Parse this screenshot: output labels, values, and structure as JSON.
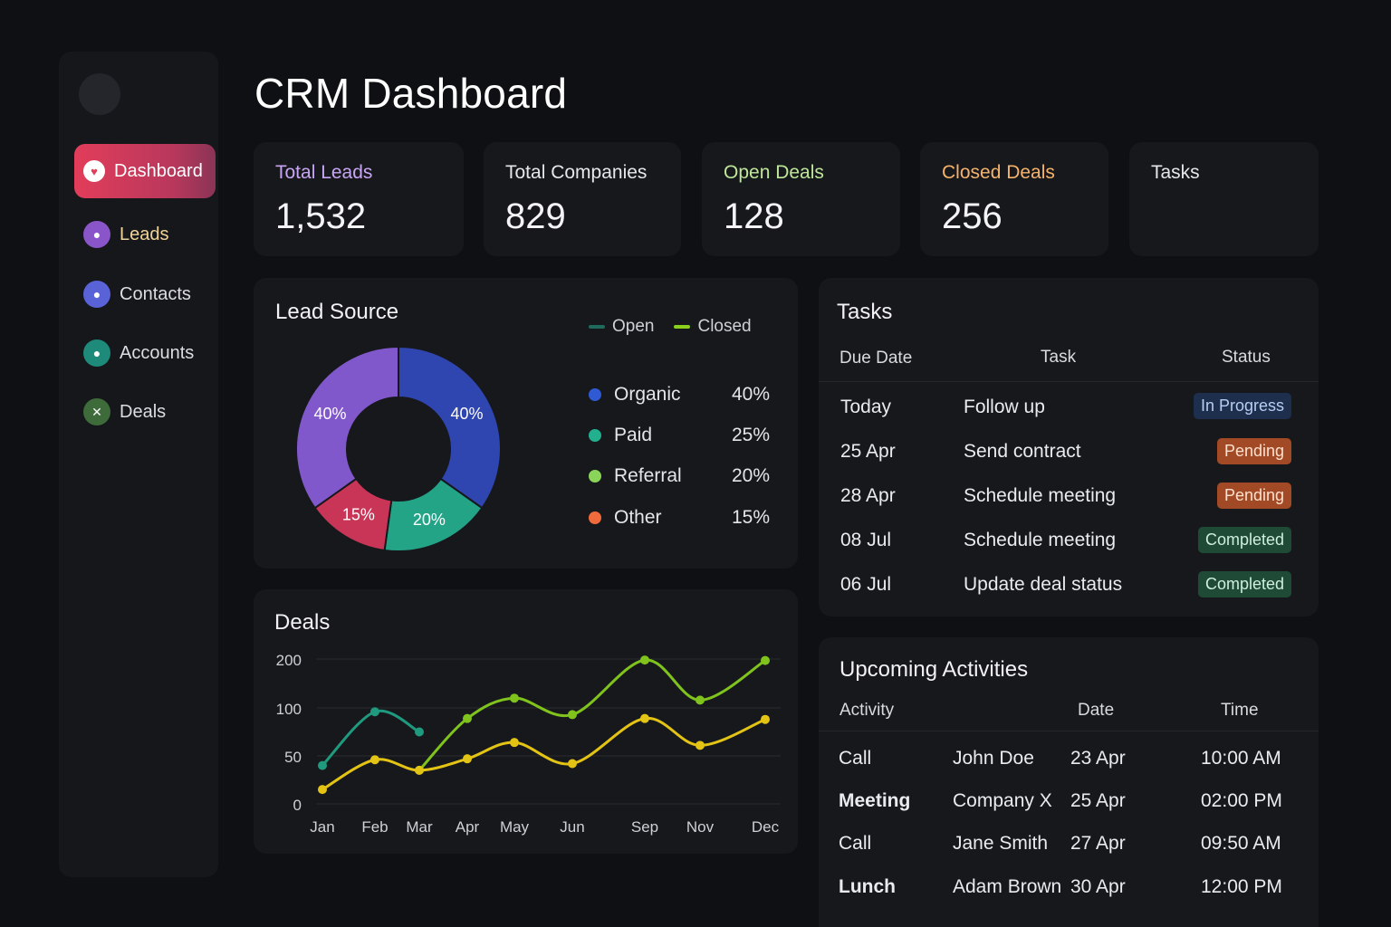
{
  "header": {
    "title": "CRM Dashboard"
  },
  "sidebar": {
    "items": [
      {
        "label": "Dashboard",
        "icon": "heart-icon",
        "active": true
      },
      {
        "label": "Leads",
        "icon": "user-icon",
        "color": "#8a55c9"
      },
      {
        "label": "Contacts",
        "icon": "user-icon",
        "color": "#5a62d8"
      },
      {
        "label": "Accounts",
        "icon": "user-icon",
        "color": "#1e8a7a"
      },
      {
        "label": "Deals",
        "icon": "close-icon",
        "color": "#3d6b3a"
      }
    ]
  },
  "kpis": [
    {
      "label": "Total Leads",
      "value": "1,532",
      "color": "#c8a6f5"
    },
    {
      "label": "Total Companies",
      "value": "829",
      "color": "#e6e7eb"
    },
    {
      "label": "Open Deals",
      "value": "128",
      "color": "#bfe79a"
    },
    {
      "label": "Closed Deals",
      "value": "256",
      "color": "#f5b36c"
    },
    {
      "label": "Tasks",
      "value": "",
      "color": "#e6e7eb"
    }
  ],
  "lead_source": {
    "title": "Lead Source",
    "legend": {
      "open": "Open",
      "closed": "Closed",
      "open_color": "#1e6b5c",
      "closed_color": "#8bd11c"
    },
    "rows": [
      {
        "label": "Organic",
        "pct": "40%",
        "color": "#2f5ad4"
      },
      {
        "label": "Paid",
        "pct": "25%",
        "color": "#22b08f"
      },
      {
        "label": "Referral",
        "pct": "20%",
        "color": "#8bd45a"
      },
      {
        "label": "Other",
        "pct": "15%",
        "color": "#f06a3c"
      }
    ]
  },
  "tasks": {
    "title": "Tasks",
    "headers": {
      "due": "Due Date",
      "task": "Task",
      "status": "Status"
    },
    "rows": [
      {
        "due": "Today",
        "task": "Follow up",
        "status": "In Progress",
        "kind": "progress"
      },
      {
        "due": "25 Apr",
        "task": "Send contract",
        "status": "Pending",
        "kind": "pending"
      },
      {
        "due": "28 Apr",
        "task": "Schedule meeting",
        "status": "Pending",
        "kind": "pending"
      },
      {
        "due": "08 Jul",
        "task": "Schedule meeting",
        "status": "Completed",
        "kind": "completed"
      },
      {
        "due": "06 Jul",
        "task": "Update deal status",
        "status": "Completed",
        "kind": "completed"
      }
    ]
  },
  "activities": {
    "title": "Upcoming Activities",
    "headers": {
      "activity": "Activity",
      "date": "Date",
      "time": "Time"
    },
    "rows": [
      {
        "activity": "Call",
        "who": "John Doe",
        "date": "23 Apr",
        "time": "10:00 AM",
        "bold": false
      },
      {
        "activity": "Meeting",
        "who": "Company X",
        "date": "25 Apr",
        "time": "02:00 PM",
        "bold": true
      },
      {
        "activity": "Call",
        "who": "Jane Smith",
        "date": "27 Apr",
        "time": "09:50 AM",
        "bold": false
      },
      {
        "activity": "Lunch",
        "who": "Adam Brown",
        "date": "30 Apr",
        "time": "12:00 PM",
        "bold": true
      }
    ]
  },
  "chart_data": [
    {
      "type": "pie",
      "variant": "donut",
      "title": "Lead Source",
      "slices": [
        {
          "label": "40%",
          "value": 40,
          "color": "#2f45b0"
        },
        {
          "label": "20%",
          "value": 20,
          "color": "#23a487"
        },
        {
          "label": "15%",
          "value": 15,
          "color": "#c93557"
        },
        {
          "label": "40%",
          "value": 40,
          "color": "#8058cc"
        }
      ]
    },
    {
      "type": "line",
      "title": "Deals",
      "categories": [
        "Jan",
        "Feb",
        "Mar",
        "Apr",
        "May",
        "Jun",
        "Sep",
        "Nov",
        "Dec"
      ],
      "y_ticks": [
        "200",
        "100",
        "50",
        "0"
      ],
      "grid": true,
      "series": [
        {
          "color": "#1f9a7f",
          "values": [
            40,
            96,
            75,
            null,
            null,
            null,
            null,
            null,
            null
          ]
        },
        {
          "color": "#7fc31c",
          "values": [
            null,
            null,
            35,
            89,
            120,
            93,
            198,
            116,
            197
          ]
        },
        {
          "color": "#e3c414",
          "values": [
            15,
            46,
            35,
            47,
            64,
            42,
            89,
            61,
            88
          ]
        }
      ]
    }
  ]
}
